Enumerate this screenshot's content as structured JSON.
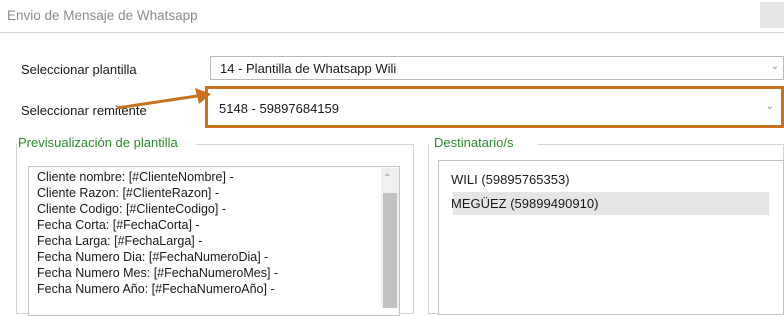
{
  "window": {
    "title": "Envio de Mensaje de Whatsapp"
  },
  "form": {
    "template_label": "Seleccionar plantilla",
    "template_value": "14 - Plantilla de Whatsapp Wili",
    "sender_label": "Seleccionar remitente",
    "sender_value": "5148 - 59897684159"
  },
  "preview": {
    "title": "Previsualización de plantilla",
    "lines": [
      "Cliente nombre: [#ClienteNombre] -",
      "Cliente Razon: [#ClienteRazon] -",
      "Cliente Codigo: [#ClienteCodigo] -",
      "Fecha Corta: [#FechaCorta] -",
      "Fecha Larga: [#FechaLarga] -",
      "Fecha Numero Dia: [#FechaNumeroDia] -",
      "Fecha Numero Mes: [#FechaNumeroMes] -",
      "Fecha Numero Año: [#FechaNumeroAño] -"
    ]
  },
  "recipients": {
    "title": "Destinatario/s",
    "items": [
      "WILI (59895765353)",
      "MEGÜEZ (59899490910)"
    ]
  },
  "colors": {
    "highlight": "#c8711f",
    "group_title": "#2d8a2d"
  },
  "icons": {
    "dropdown": "chevron-down-icon",
    "annotation": "arrow-annotation"
  }
}
